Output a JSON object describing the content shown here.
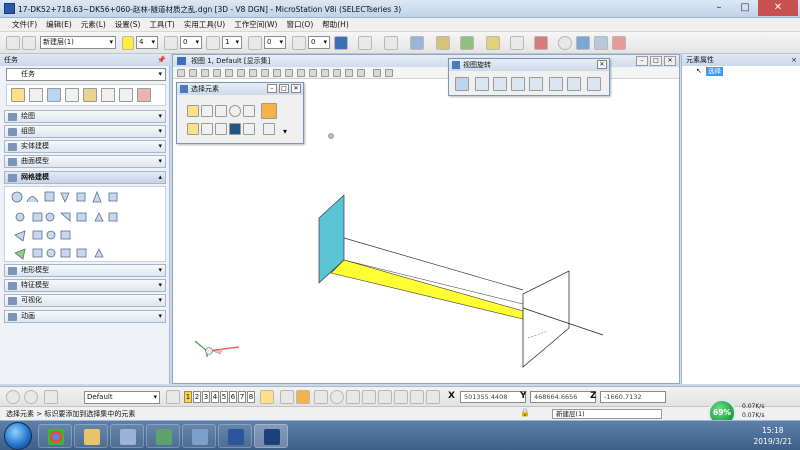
{
  "window": {
    "title": "17-DK52+718.63~DK56+060-赵林-隧道材质之乱.dgn [3D - V8 DGN] - MicroStation V8i (SELECTseries 3)"
  },
  "menu": [
    "文件(F)",
    "编辑(E)",
    "元素(L)",
    "设置(S)",
    "工具(T)",
    "实用工具(U)",
    "工作空间(W)",
    "窗口(O)",
    "帮助(H)"
  ],
  "toolbar": {
    "level": "新建层(1)",
    "color_value": "4",
    "color_swatch": "#ffef3a",
    "linestyle_value": "0",
    "weight_value": "1",
    "transparency_value": "0",
    "priority_value": "0"
  },
  "left_panel": {
    "title": "任务",
    "task_selector": "任务",
    "sections": [
      {
        "label": "绘图"
      },
      {
        "label": "组图"
      },
      {
        "label": "实体建模"
      },
      {
        "label": "曲面模型"
      },
      {
        "label": "网格建模",
        "active": true
      },
      {
        "label": "地形模型"
      },
      {
        "label": "特征模型"
      },
      {
        "label": "可视化"
      },
      {
        "label": "动画"
      }
    ]
  },
  "view": {
    "title": "视图 1, Default [显示集]"
  },
  "select_element": {
    "title": "选择元素"
  },
  "view_rotation": {
    "title": "视图旋转"
  },
  "right_panel": {
    "title": "元素属性",
    "selected": "选择"
  },
  "bottom": {
    "view_group": "Default",
    "view_numbers": [
      "1",
      "2",
      "3",
      "4",
      "5",
      "6",
      "7",
      "8"
    ],
    "x_label": "X",
    "x_value": "501355.4408",
    "y_label": "Y",
    "y_value": "468664.6656",
    "z_label": "Z",
    "z_value": "-1660.7132"
  },
  "status": {
    "message": "选择元素 > 标识要添加到选择集中的元素",
    "level": "新建层(1)"
  },
  "network": {
    "percent": "69%",
    "up": "0.07K/s",
    "down": "0.07K/s"
  },
  "clock": {
    "time": "15:18",
    "date": "2019/3/21"
  },
  "colors": {
    "slab": "#ffff33",
    "wall": "#59c4d6"
  }
}
